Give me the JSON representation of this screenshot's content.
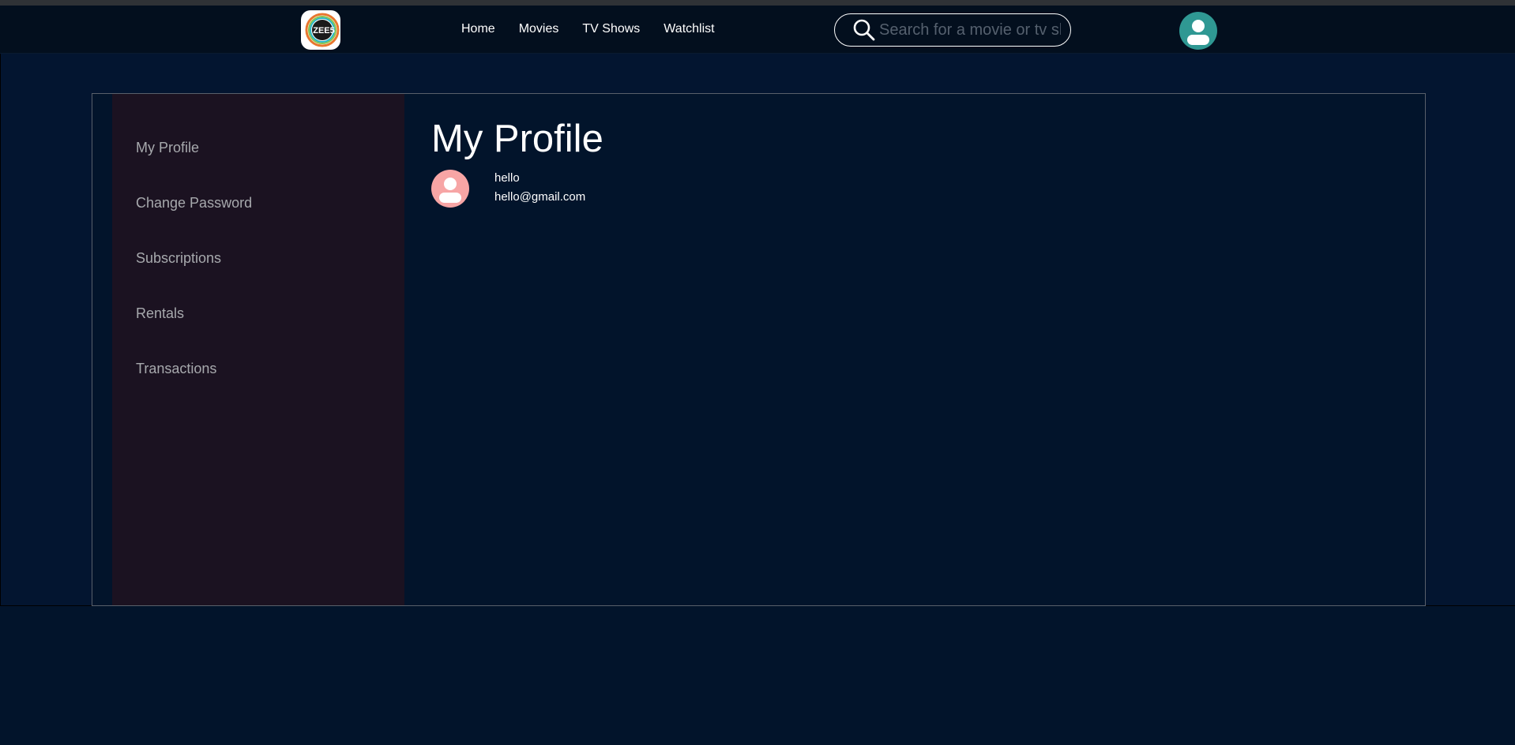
{
  "header": {
    "logo_text": "ZEE5",
    "nav": [
      {
        "label": "Home"
      },
      {
        "label": "Movies"
      },
      {
        "label": "TV Shows"
      },
      {
        "label": "Watchlist"
      }
    ],
    "search": {
      "placeholder": "Search for a movie or tv show",
      "value": ""
    },
    "icons": {
      "search": "search-icon",
      "avatar": "user-avatar-icon"
    }
  },
  "sidebar": {
    "items": [
      {
        "label": "My Profile"
      },
      {
        "label": "Change Password"
      },
      {
        "label": "Subscriptions"
      },
      {
        "label": "Rentals"
      },
      {
        "label": "Transactions"
      }
    ]
  },
  "profile": {
    "title": "My Profile",
    "name": "hello",
    "email": "hello@gmail.com"
  },
  "colors": {
    "background": "#02142b",
    "header": "#030f1e",
    "sidebar": "#1b1221",
    "avatar_top": "#2f9893",
    "avatar_profile": "#f7a5a5"
  }
}
